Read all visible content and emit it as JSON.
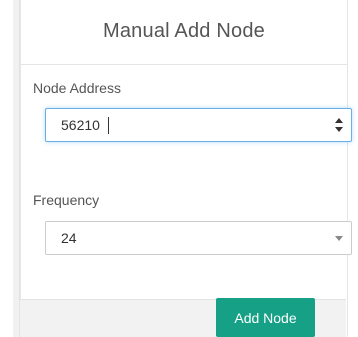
{
  "panel": {
    "title": "Manual Add Node"
  },
  "form": {
    "node_address": {
      "label": "Node Address",
      "value": "56210"
    },
    "frequency": {
      "label": "Frequency",
      "selected": "24"
    }
  },
  "actions": {
    "add_node_label": "Add Node"
  },
  "colors": {
    "accent": "#16a085",
    "focus_border": "#66afe9"
  },
  "icons": {
    "spinner": "number-spinner-icon",
    "dropdown": "chevron-down-icon"
  }
}
